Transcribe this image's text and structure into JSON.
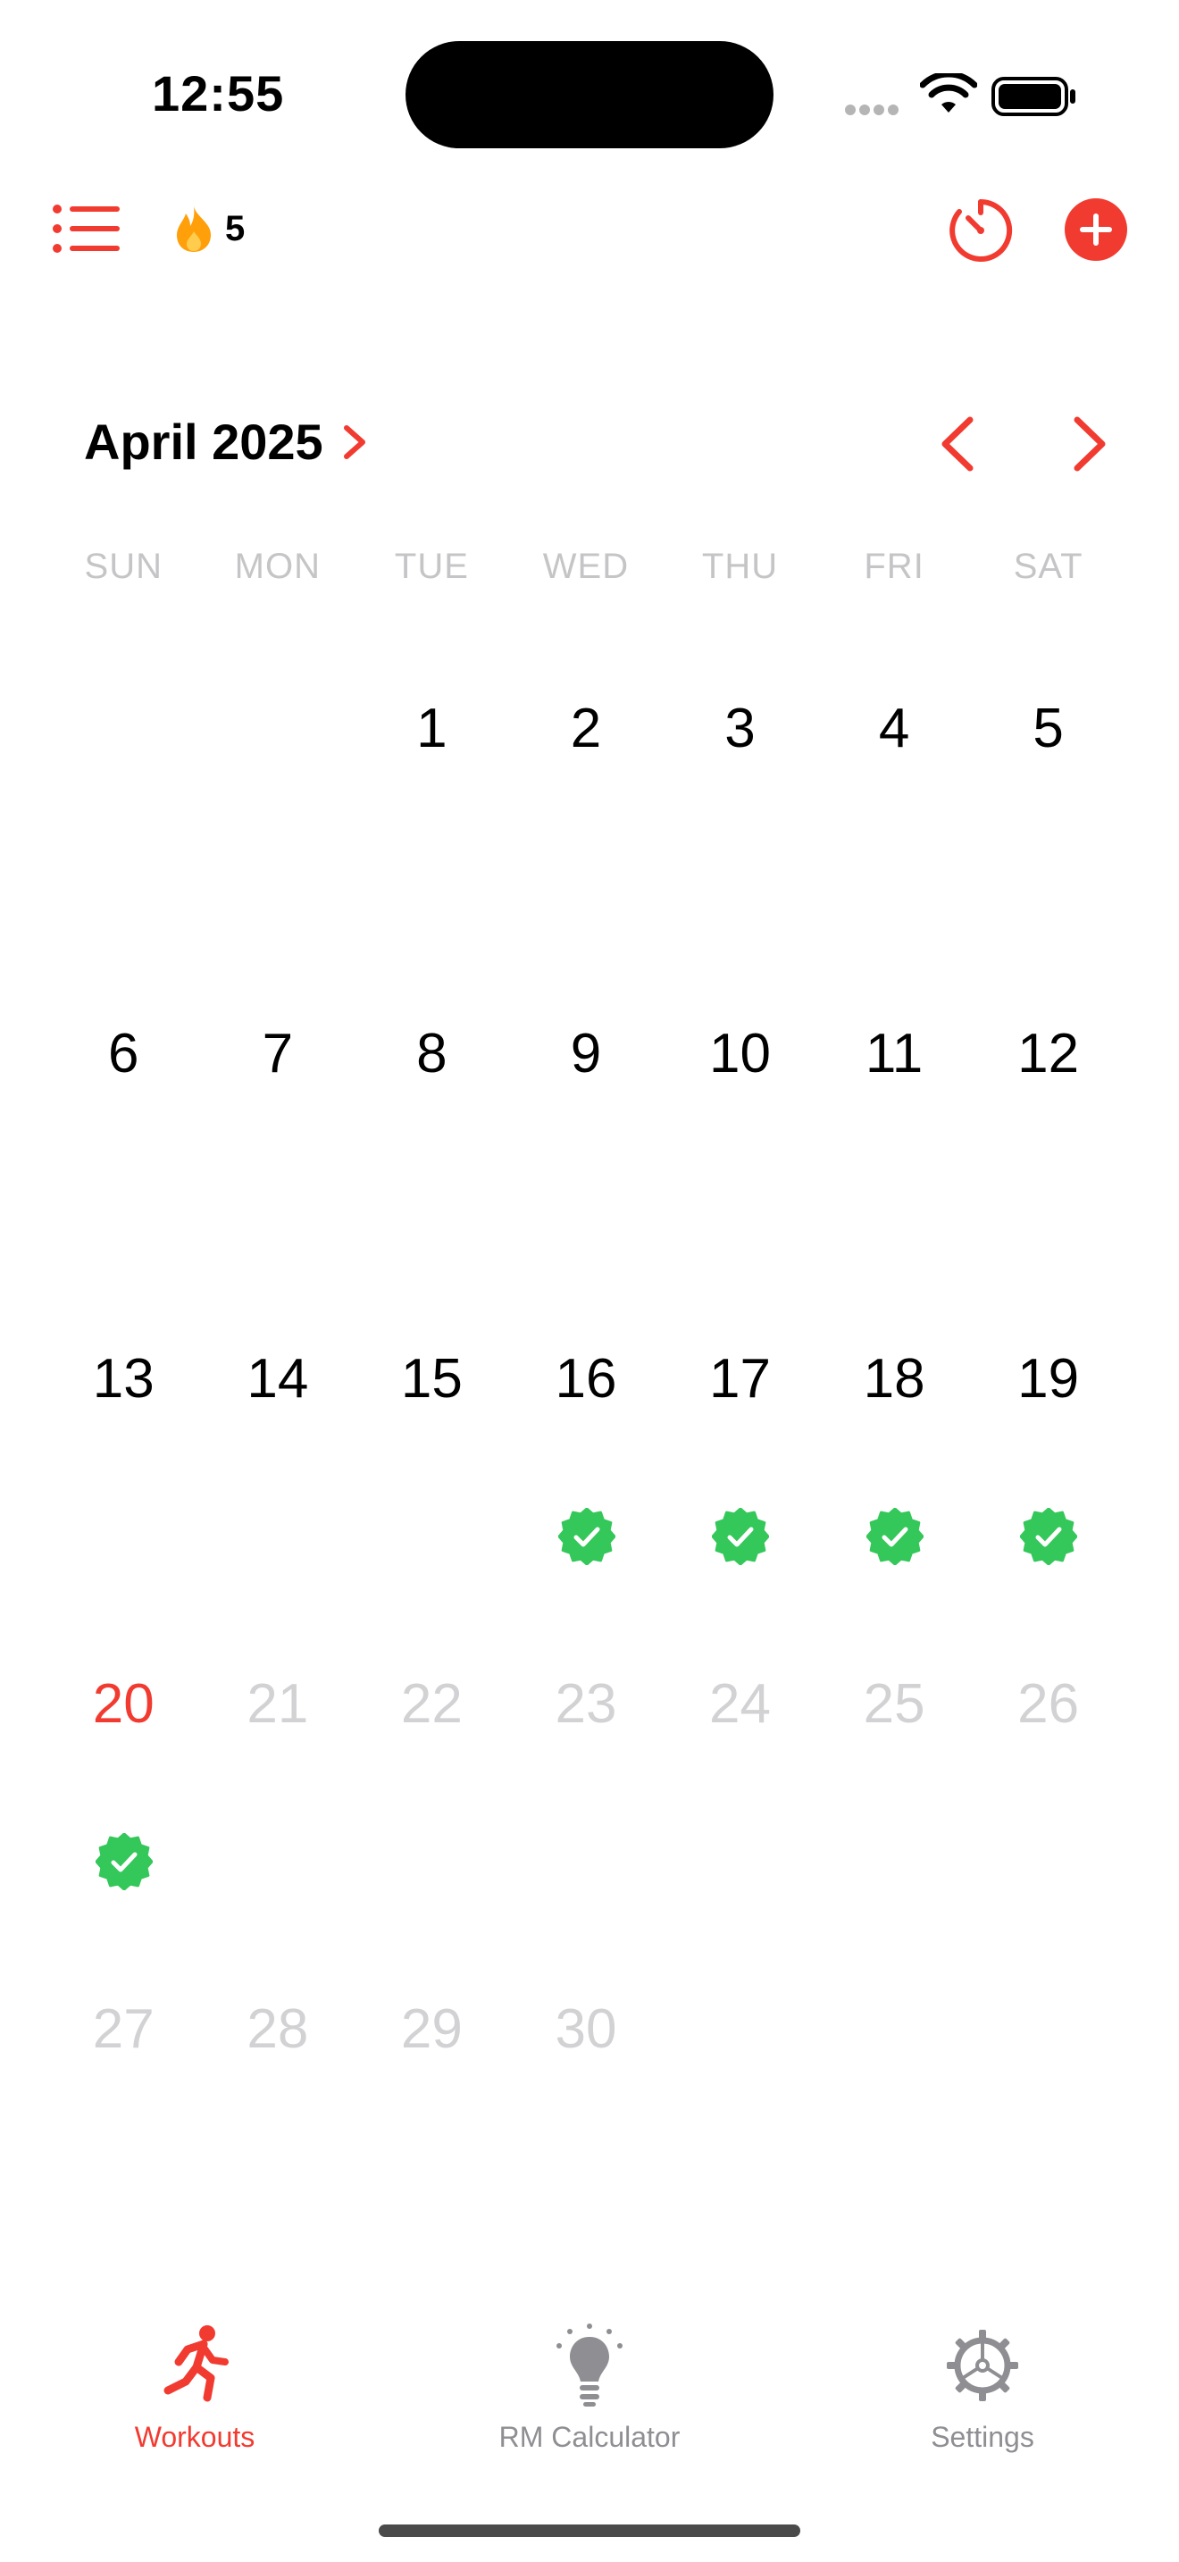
{
  "status_bar": {
    "time": "12:55"
  },
  "toolbar": {
    "streak_count": "5"
  },
  "calendar": {
    "month_title": "April 2025",
    "weekdays": [
      "SUN",
      "MON",
      "TUE",
      "WED",
      "THU",
      "FRI",
      "SAT"
    ],
    "weeks": [
      [
        {
          "day": "",
          "state": "empty",
          "completed": false
        },
        {
          "day": "",
          "state": "empty",
          "completed": false
        },
        {
          "day": "1",
          "state": "normal",
          "completed": false
        },
        {
          "day": "2",
          "state": "normal",
          "completed": false
        },
        {
          "day": "3",
          "state": "normal",
          "completed": false
        },
        {
          "day": "4",
          "state": "normal",
          "completed": false
        },
        {
          "day": "5",
          "state": "normal",
          "completed": false
        }
      ],
      [
        {
          "day": "6",
          "state": "normal",
          "completed": false
        },
        {
          "day": "7",
          "state": "normal",
          "completed": false
        },
        {
          "day": "8",
          "state": "normal",
          "completed": false
        },
        {
          "day": "9",
          "state": "normal",
          "completed": false
        },
        {
          "day": "10",
          "state": "normal",
          "completed": false
        },
        {
          "day": "11",
          "state": "normal",
          "completed": false
        },
        {
          "day": "12",
          "state": "normal",
          "completed": false
        }
      ],
      [
        {
          "day": "13",
          "state": "normal",
          "completed": false
        },
        {
          "day": "14",
          "state": "normal",
          "completed": false
        },
        {
          "day": "15",
          "state": "normal",
          "completed": false
        },
        {
          "day": "16",
          "state": "normal",
          "completed": true
        },
        {
          "day": "17",
          "state": "normal",
          "completed": true
        },
        {
          "day": "18",
          "state": "normal",
          "completed": true
        },
        {
          "day": "19",
          "state": "normal",
          "completed": true
        }
      ],
      [
        {
          "day": "20",
          "state": "today",
          "completed": true
        },
        {
          "day": "21",
          "state": "future",
          "completed": false
        },
        {
          "day": "22",
          "state": "future",
          "completed": false
        },
        {
          "day": "23",
          "state": "future",
          "completed": false
        },
        {
          "day": "24",
          "state": "future",
          "completed": false
        },
        {
          "day": "25",
          "state": "future",
          "completed": false
        },
        {
          "day": "26",
          "state": "future",
          "completed": false
        }
      ],
      [
        {
          "day": "27",
          "state": "future",
          "completed": false
        },
        {
          "day": "28",
          "state": "future",
          "completed": false
        },
        {
          "day": "29",
          "state": "future",
          "completed": false
        },
        {
          "day": "30",
          "state": "future",
          "completed": false
        },
        {
          "day": "",
          "state": "empty",
          "completed": false
        },
        {
          "day": "",
          "state": "empty",
          "completed": false
        },
        {
          "day": "",
          "state": "empty",
          "completed": false
        }
      ]
    ]
  },
  "tab_bar": {
    "tabs": [
      {
        "label": "Workouts",
        "icon": "running-figure-icon",
        "active": true
      },
      {
        "label": "RM Calculator",
        "icon": "lightbulb-icon",
        "active": false
      },
      {
        "label": "Settings",
        "icon": "gear-icon",
        "active": false
      }
    ]
  },
  "colors": {
    "accent": "#f23b30",
    "completed_badge": "#34c759",
    "streak_flame": "#ff9f0a",
    "dim_text": "#d2d2d4",
    "weekday_text": "#c5c5c7",
    "inactive_tab": "#8e8e93"
  }
}
